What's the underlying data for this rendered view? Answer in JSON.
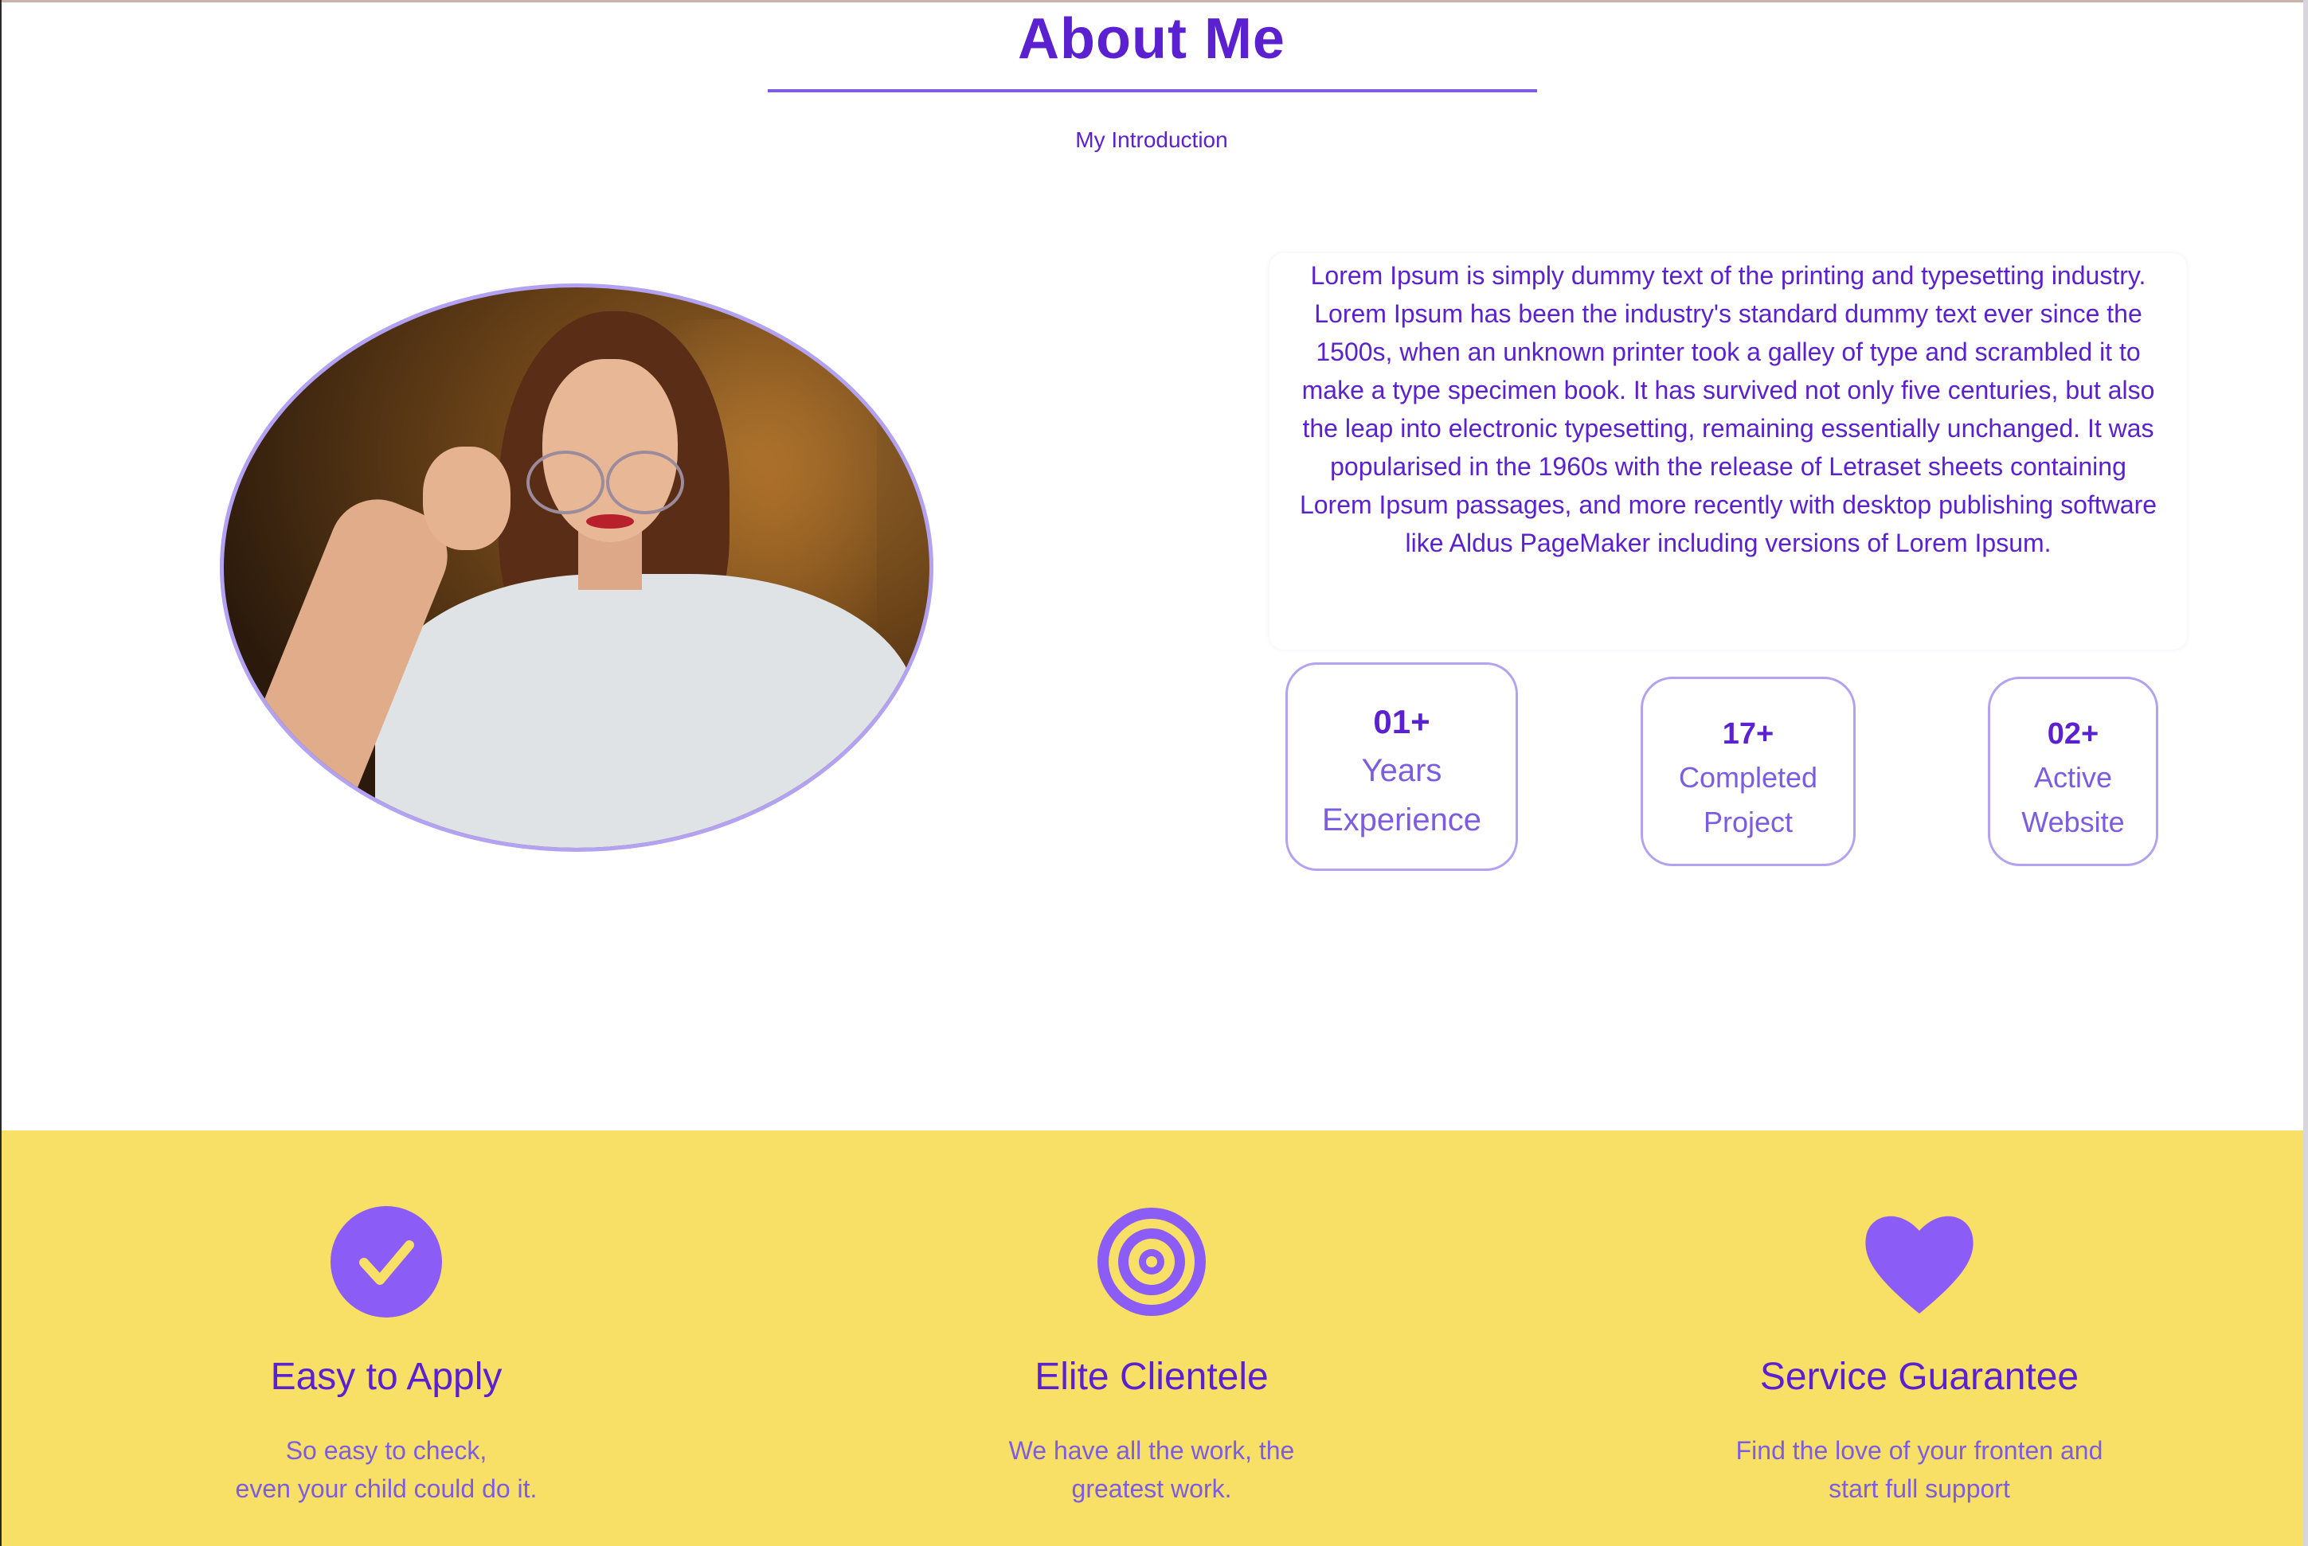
{
  "colors": {
    "primary": "#5b21d1",
    "accent": "#8b5cf6",
    "border": "#b3a1f2",
    "feature_bg": "#f8e066"
  },
  "about": {
    "title": "About Me",
    "subtitle": "My Introduction",
    "photo_alt": "portrait-photo",
    "intro": "Lorem Ipsum is simply dummy text of the printing and typesetting industry. Lorem Ipsum has been the industry's standard dummy text ever since the 1500s, when an unknown printer took a galley of type and scrambled it to make a type specimen book. It has survived not only five centuries, but also the leap into electronic typesetting, remaining essentially unchanged. It was popularised in the 1960s with the release of Letraset sheets containing Lorem Ipsum passages, and more recently with desktop publishing software like Aldus PageMaker including versions of Lorem Ipsum."
  },
  "stats": [
    {
      "number": "01+",
      "label_line1": "Years",
      "label_line2": "Experience"
    },
    {
      "number": "17+",
      "label_line1": "Completed",
      "label_line2": "Project"
    },
    {
      "number": "02+",
      "label_line1": "Active",
      "label_line2": "Website"
    }
  ],
  "features": [
    {
      "icon": "check-circle-icon",
      "title": "Easy to Apply",
      "desc_line1": "So easy to check,",
      "desc_line2": "even your child could do it."
    },
    {
      "icon": "target-icon",
      "title": "Elite Clientele",
      "desc_line1": "We have all the work, the",
      "desc_line2": "greatest work."
    },
    {
      "icon": "heart-icon",
      "title": "Service Guarantee",
      "desc_line1": "Find the love of your fronten and",
      "desc_line2": "start full support"
    }
  ]
}
